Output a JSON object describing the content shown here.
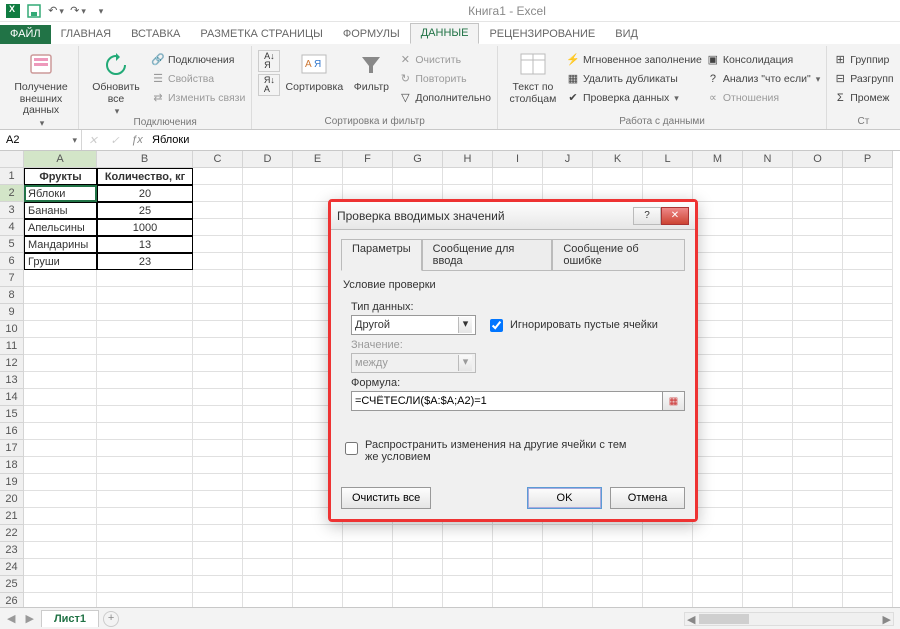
{
  "titlebar": {
    "title": "Книга1 - Excel"
  },
  "tabs": {
    "file": "ФАЙЛ",
    "items": [
      "ГЛАВНАЯ",
      "ВСТАВКА",
      "РАЗМЕТКА СТРАНИЦЫ",
      "ФОРМУЛЫ",
      "ДАННЫЕ",
      "РЕЦЕНЗИРОВАНИЕ",
      "ВИД"
    ],
    "active_index": 4
  },
  "ribbon": {
    "groups": {
      "g1_label": "",
      "get_external": "Получение внешних данных",
      "connections_label": "Подключения",
      "refresh_all": "Обновить все",
      "connections": "Подключения",
      "properties": "Свойства",
      "edit_links": "Изменить связи",
      "sort_filter_label": "Сортировка и фильтр",
      "sort": "Сортировка",
      "filter": "Фильтр",
      "clear": "Очистить",
      "reapply": "Повторить",
      "advanced": "Дополнительно",
      "data_tools_label": "Работа с данными",
      "text_to_columns": "Текст по столбцам",
      "flash_fill": "Мгновенное заполнение",
      "remove_dupes": "Удалить дубликаты",
      "data_validation": "Проверка данных",
      "consolidate": "Консолидация",
      "whatif": "Анализ \"что если\"",
      "relationships": "Отношения",
      "outline_label": "Ст",
      "group": "Группир",
      "ungroup": "Разгрупп",
      "subtotal": "Промеж"
    }
  },
  "namebox": {
    "ref": "A2"
  },
  "formula_bar": {
    "value": "Яблоки"
  },
  "columns": [
    "A",
    "B",
    "C",
    "D",
    "E",
    "F",
    "G",
    "H",
    "I",
    "J",
    "K",
    "L",
    "M",
    "N",
    "O",
    "P"
  ],
  "row_count": 27,
  "table": {
    "header": [
      "Фрукты",
      "Количество, кг"
    ],
    "rows": [
      [
        "Яблоки",
        "20"
      ],
      [
        "Бананы",
        "25"
      ],
      [
        "Апельсины",
        "1000"
      ],
      [
        "Мандарины",
        "13"
      ],
      [
        "Груши",
        "23"
      ]
    ]
  },
  "sheet_tabs": {
    "active": "Лист1"
  },
  "dialog": {
    "title": "Проверка вводимых значений",
    "tabs": [
      "Параметры",
      "Сообщение для ввода",
      "Сообщение об ошибке"
    ],
    "active_tab": 0,
    "section": "Условие проверки",
    "type_label": "Тип данных:",
    "type_value": "Другой",
    "ignore_blank": "Игнорировать пустые ячейки",
    "ignore_blank_checked": true,
    "data_label": "Значение:",
    "data_value": "между",
    "formula_label": "Формула:",
    "formula_value": "=СЧЁТЕСЛИ($A:$A;A2)=1",
    "propagate": "Распространить изменения на другие ячейки с тем же условием",
    "propagate_checked": false,
    "clear_all": "Очистить все",
    "ok": "OK",
    "cancel": "Отмена"
  }
}
